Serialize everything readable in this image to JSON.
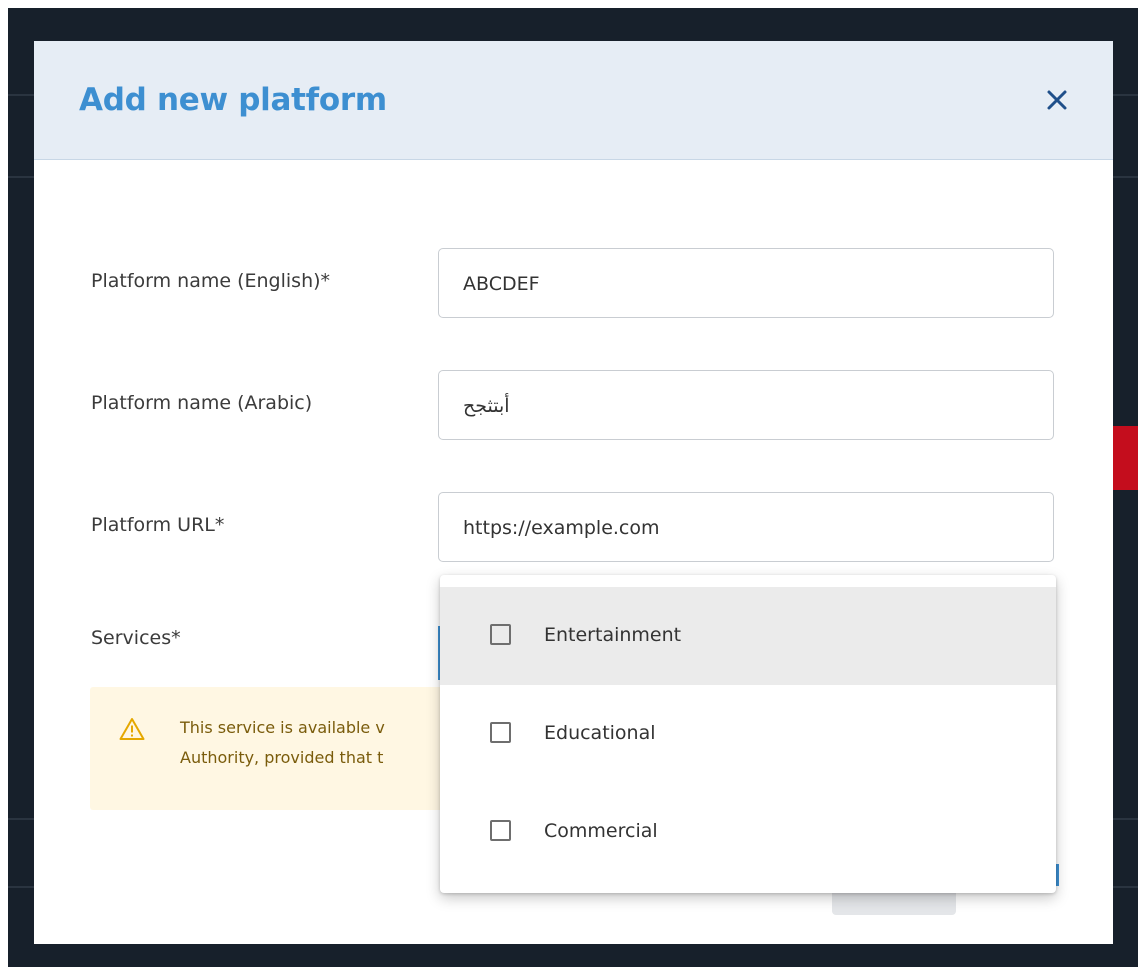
{
  "colors": {
    "accent": "#3d8fd1",
    "backdrop": "#17202b",
    "header_bg": "#e6edf5",
    "alert_bg": "#fff7e3",
    "alert_text": "#7a5c0c",
    "danger": "#c40d1d"
  },
  "modal": {
    "title": "Add new platform",
    "close_icon": "close-icon"
  },
  "form": {
    "name_en": {
      "label": "Platform name (English)*",
      "value": "ABCDEF"
    },
    "name_ar": {
      "label": "Platform name (Arabic)",
      "value": "أبتثجح"
    },
    "url": {
      "label": "Platform URL*",
      "value": "https://example.com"
    },
    "services": {
      "label": "Services*"
    }
  },
  "alert": {
    "icon": "warning-icon",
    "line1": "This service is available v",
    "line2": "Authority, provided that t"
  },
  "dropdown": {
    "options": [
      {
        "label": "Entertainment",
        "checked": false,
        "highlighted": true
      },
      {
        "label": "Educational",
        "checked": false,
        "highlighted": false
      },
      {
        "label": "Commercial",
        "checked": false,
        "highlighted": false
      }
    ]
  }
}
